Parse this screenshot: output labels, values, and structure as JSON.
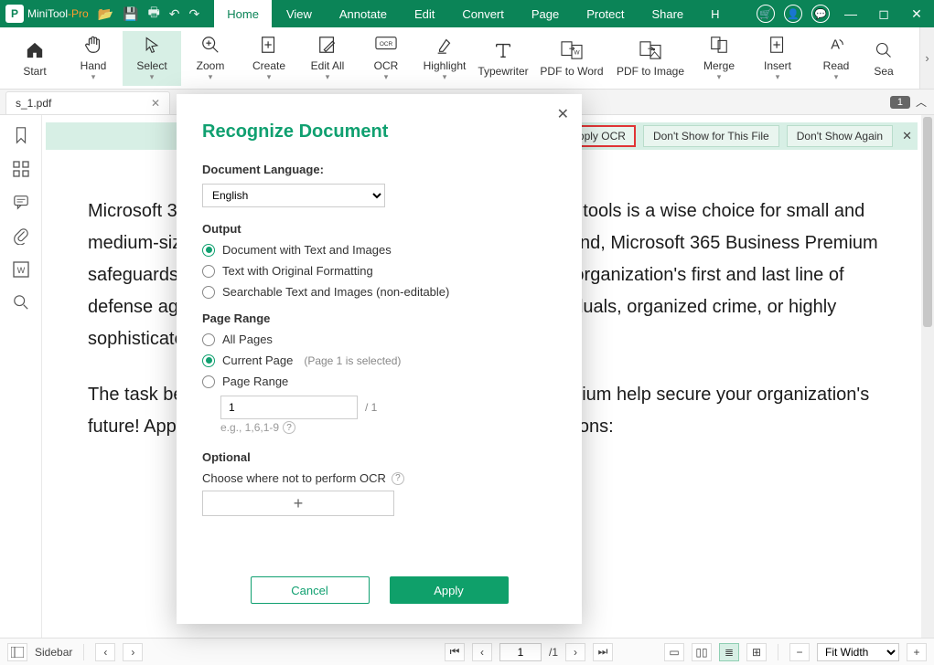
{
  "app": {
    "name": "MiniTool",
    "suffix": "-Pro"
  },
  "menus": [
    "Home",
    "View",
    "Annotate",
    "Edit",
    "Convert",
    "Page",
    "Protect",
    "Share",
    "H"
  ],
  "active_menu": 0,
  "ribbon": [
    {
      "label": "Start",
      "icon": "home-icon",
      "drop": false
    },
    {
      "label": "Hand",
      "icon": "hand-icon",
      "drop": true
    },
    {
      "label": "Select",
      "icon": "cursor-icon",
      "drop": true,
      "selected": true
    },
    {
      "label": "Zoom",
      "icon": "zoom-icon",
      "drop": true
    },
    {
      "label": "Create",
      "icon": "create-icon",
      "drop": true
    },
    {
      "label": "Edit All",
      "icon": "edit-icon",
      "drop": true
    },
    {
      "label": "OCR",
      "icon": "ocr-icon",
      "drop": true
    },
    {
      "label": "Highlight",
      "icon": "highlight-icon",
      "drop": true
    },
    {
      "label": "Typewriter",
      "icon": "type-icon",
      "drop": false
    },
    {
      "label": "PDF to Word",
      "icon": "toword-icon",
      "drop": false,
      "wider": true
    },
    {
      "label": "PDF to Image",
      "icon": "toimage-icon",
      "drop": false,
      "wider": true
    },
    {
      "label": "Merge",
      "icon": "merge-icon",
      "drop": true
    },
    {
      "label": "Insert",
      "icon": "insert-icon",
      "drop": true
    },
    {
      "label": "Read",
      "icon": "read-icon",
      "drop": true
    },
    {
      "label": "Sea",
      "icon": "search-icon",
      "drop": false
    }
  ],
  "tabs": {
    "current": "s_1.pdf",
    "badge": "1"
  },
  "ocrbar": {
    "apply": "Apply OCR",
    "dontshowfile": "Don't Show for This File",
    "dontshowagain": "Don't Show Again"
  },
  "document": {
    "p1": "Microsoft 365 Business Premium with its suite of productivity tools is a wise choice for small and medium-sized businesses. Designed with cybersecurity in mind, Microsoft 365 Business Premium safeguards your environment and information. You are your organization's first and last line of defense against and cyberattackers, including random individuals, organized crime, or highly sophisticated nation states.",
    "p2": "The task before you is this—let Microsoft 365 Business Premium help secure your organization's future! Approach this task by taking on the following six missions:"
  },
  "status": {
    "sidebar_label": "Sidebar",
    "page_current": "1",
    "page_total": "/1",
    "zoom_label": "Fit Width"
  },
  "dialog": {
    "title": "Recognize Document",
    "lang_label": "Document Language:",
    "lang_value": "English",
    "output_label": "Output",
    "output_options": [
      "Document with Text and Images",
      "Text with Original Formatting",
      "Searchable Text and Images (non-editable)"
    ],
    "output_selected": 0,
    "range_label": "Page Range",
    "range_options": [
      "All Pages",
      "Current Page",
      "Page Range"
    ],
    "range_selected": 1,
    "range_hint": "(Page 1 is selected)",
    "range_input_value": "1",
    "range_total": "/ 1",
    "range_example": "e.g., 1,6,1-9",
    "optional_label": "Optional",
    "optional_desc": "Choose where not to perform OCR",
    "cancel": "Cancel",
    "apply": "Apply"
  }
}
